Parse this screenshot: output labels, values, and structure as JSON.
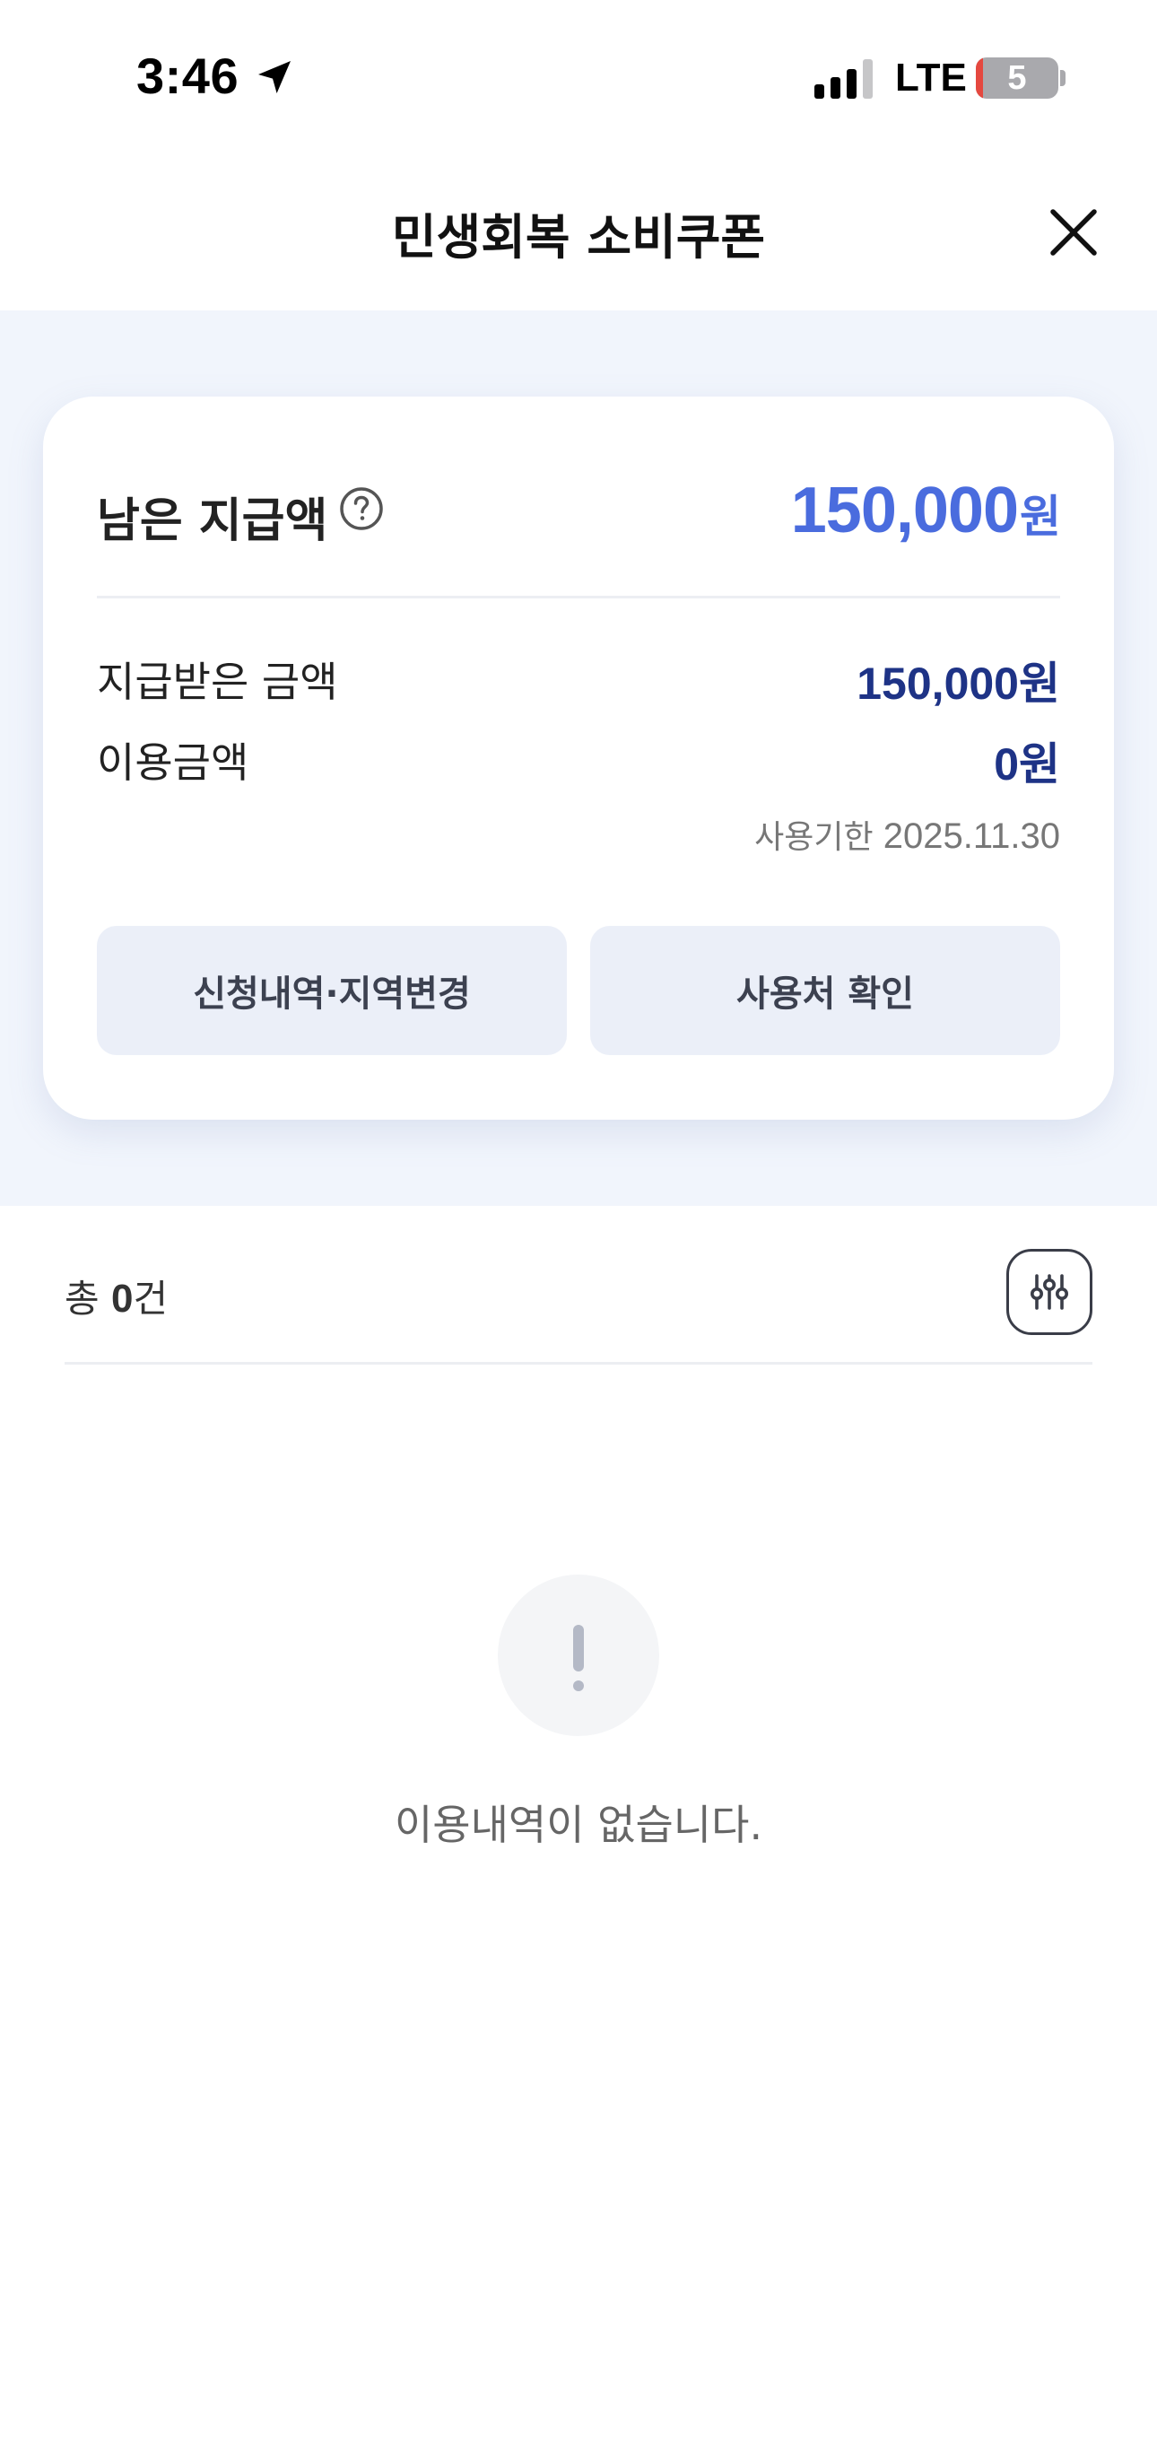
{
  "status_bar": {
    "time": "3:46",
    "network": "LTE",
    "battery": "5"
  },
  "header": {
    "title": "민생회복 소비쿠폰",
    "close_icon": "close-icon"
  },
  "summary": {
    "remaining_label": "남은 지급액",
    "remaining_amount": "150,000",
    "remaining_unit": "원",
    "received_label": "지급받은 금액",
    "received_amount": "150,000원",
    "used_label": "이용금액",
    "used_amount": "0원",
    "expiry_label": "사용기한",
    "expiry_date": "2025.11.30",
    "buttons": {
      "history_region": "신청내역·지역변경",
      "merchants": "사용처 확인"
    },
    "colors": {
      "accent": "#4a6cde",
      "value_navy": "#1e3386",
      "section_bg": "#f1f5fc"
    }
  },
  "list": {
    "total_prefix": "총",
    "total_count": "0",
    "total_suffix": "건",
    "filter_icon": "filter-sliders-icon",
    "empty_message": "이용내역이 없습니다."
  }
}
